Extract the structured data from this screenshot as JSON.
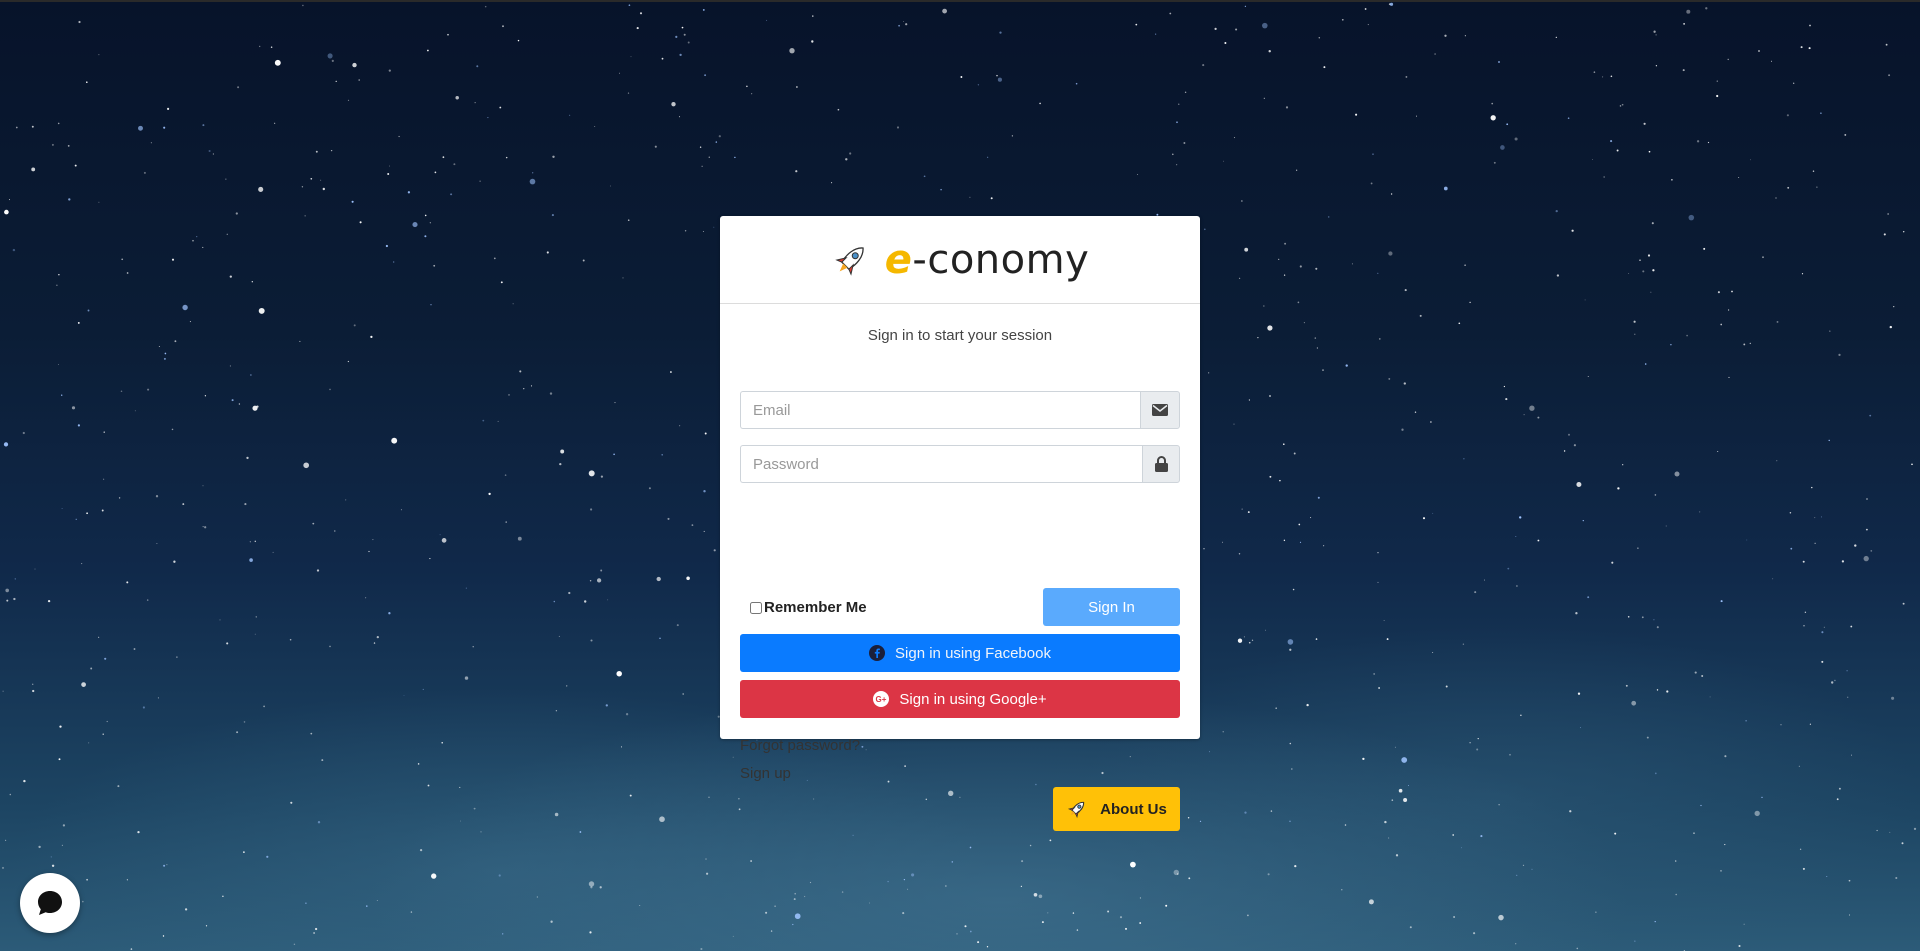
{
  "brand": {
    "prefix": "e",
    "suffix": "-conomy",
    "icon": "rocket-icon"
  },
  "login": {
    "message": "Sign in to start your session",
    "email_placeholder": "Email",
    "password_placeholder": "Password",
    "remember_label": "Remember Me",
    "remember_checked": false,
    "signin_label": "Sign In",
    "facebook_label": "Sign in using Facebook",
    "google_label": "Sign in using Google+",
    "forgot_label": "Forgot password?",
    "signup_label": "Sign up",
    "about_label": "About Us"
  },
  "icons": {
    "email": "envelope-icon",
    "password": "lock-icon",
    "facebook": "facebook-icon",
    "google": "google-plus-icon",
    "chat": "chat-bubble-icon"
  },
  "colors": {
    "brand_accent": "#f5b800",
    "signin": "#5aaafd",
    "facebook": "#0a7bff",
    "google": "#dc3545",
    "about": "#ffc107"
  }
}
